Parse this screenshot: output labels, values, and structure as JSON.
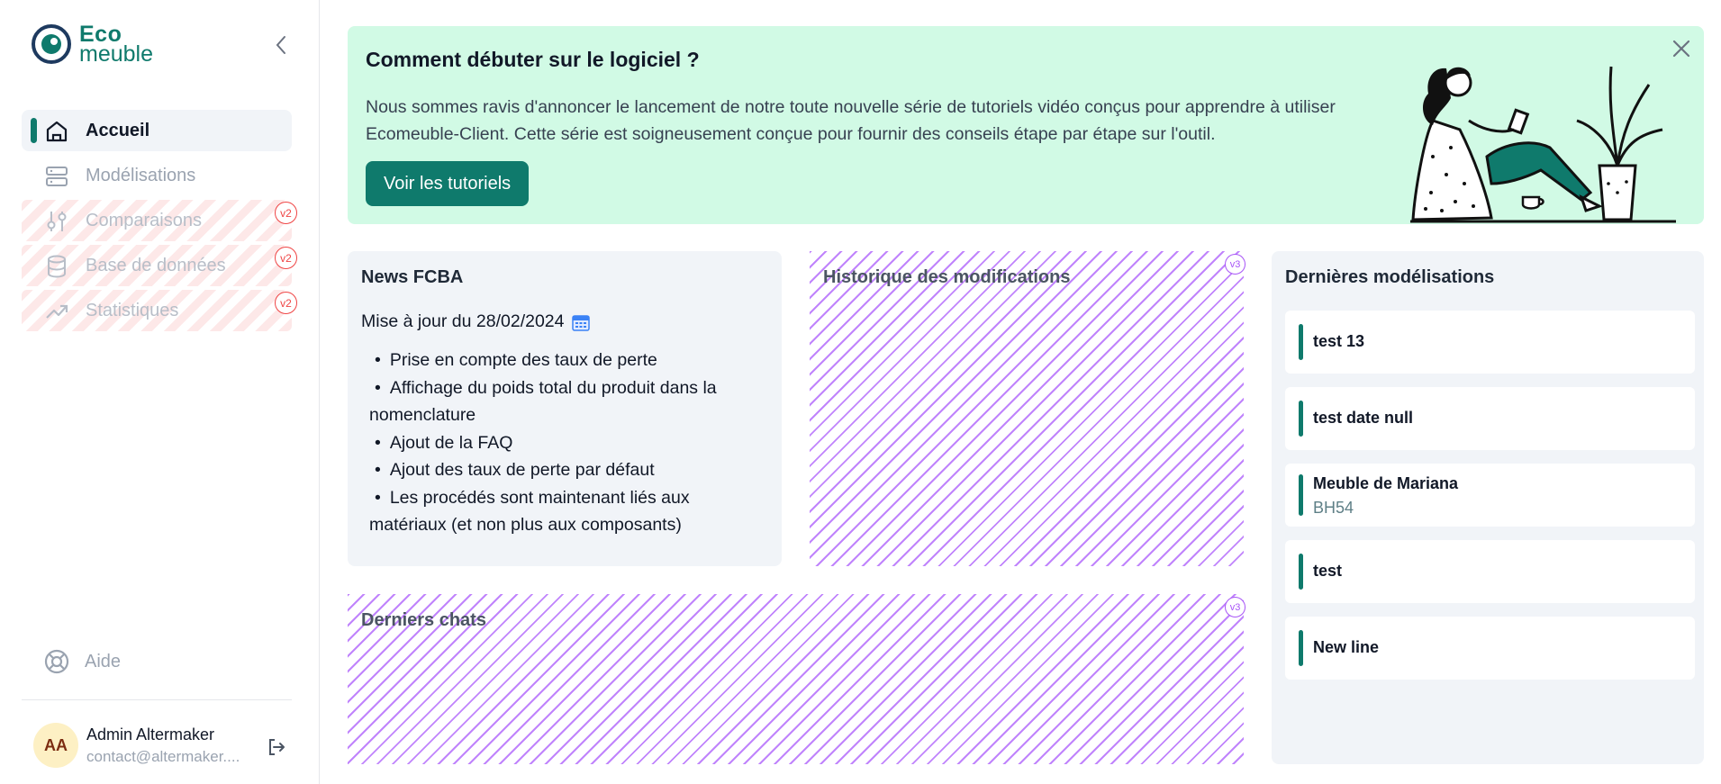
{
  "app": {
    "logo_line1": "Eco",
    "logo_line2": "meuble"
  },
  "sidebar": {
    "items": [
      {
        "label": "Accueil",
        "icon": "home-icon",
        "active": true
      },
      {
        "label": "Modélisations",
        "icon": "server-icon",
        "active": false
      },
      {
        "label": "Comparaisons",
        "icon": "sliders-icon",
        "badge": "v2"
      },
      {
        "label": "Base de données",
        "icon": "database-icon",
        "badge": "v2"
      },
      {
        "label": "Statistiques",
        "icon": "trending-up-icon",
        "badge": "v2"
      }
    ],
    "help_label": "Aide",
    "user": {
      "initials": "AA",
      "name": "Admin Altermaker",
      "email": "contact@altermaker...."
    }
  },
  "banner": {
    "title": "Comment débuter sur le logiciel ?",
    "text": "Nous sommes ravis d'annoncer le lancement de notre toute nouvelle série de tutoriels vidéo conçus pour apprendre à utiliser Ecomeuble-Client. Cette série est soigneusement conçue pour fournir des conseils étape par étape sur l'outil.",
    "button_label": "Voir les tutoriels"
  },
  "news": {
    "title": "News FCBA",
    "update": "Mise à jour du 28/02/2024",
    "items": [
      "Prise en compte des taux de perte",
      "Affichage du poids total du produit dans la nomenclature",
      "Ajout de la FAQ",
      "Ajout des taux de perte par défaut",
      "Les procédés sont maintenant liés aux matériaux (et non plus aux composants)"
    ]
  },
  "history": {
    "title": "Historique des modifications",
    "badge": "v3"
  },
  "chats": {
    "title": "Derniers chats",
    "badge": "v3"
  },
  "models": {
    "title": "Dernières modélisations",
    "items": [
      {
        "name": "test 13",
        "code": ""
      },
      {
        "name": "test date null",
        "code": ""
      },
      {
        "name": "Meuble de Mariana",
        "code": "BH54"
      },
      {
        "name": "test",
        "code": ""
      },
      {
        "name": "New line",
        "code": ""
      }
    ]
  },
  "colors": {
    "brand": "#0f7a6c",
    "banner_bg": "#d1fae5",
    "card_bg": "#f1f4f8",
    "v2_badge": "#ef4444",
    "v3_badge": "#a855f7"
  }
}
